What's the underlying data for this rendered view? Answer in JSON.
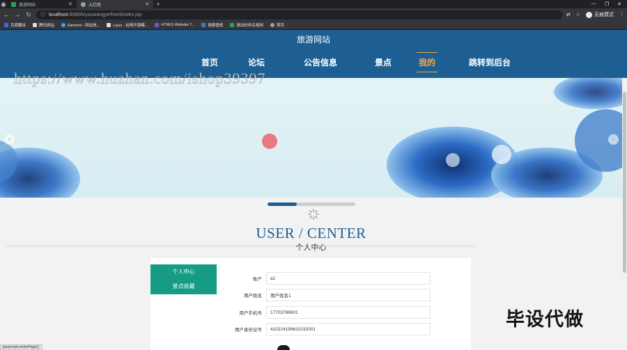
{
  "browser": {
    "tabs": [
      {
        "label": "旅游网站",
        "active": false
      },
      {
        "label": "入口页",
        "active": true
      }
    ],
    "new_tab_symbol": "+",
    "url_host": "localhost",
    "url_path": ":8080/lvyouwangye/front/index.jsp",
    "incognito_label": "无痕模式",
    "bookmarks": [
      {
        "label": "百度翻译",
        "color": "#3b6fd8"
      },
      {
        "label": "腾讯网站",
        "color": "#dddddd"
      },
      {
        "label": "Element - 网站快...",
        "color": "#409eff"
      },
      {
        "label": "Layui - 经典开源模...",
        "color": "#dddddd"
      },
      {
        "label": "HTML5 Website T...",
        "color": "#6a5acd"
      },
      {
        "label": "搜索壁纸",
        "color": "#3a7bd5"
      },
      {
        "label": "滚动的命名规则",
        "color": "#2e9e5b"
      },
      {
        "label": "首页",
        "color": "#9aa0a6"
      }
    ]
  },
  "site": {
    "title": "旅游网站",
    "nav": [
      {
        "label": "首页",
        "active": false
      },
      {
        "label": "论坛",
        "active": false
      },
      {
        "label": "公告信息",
        "active": false
      },
      {
        "label": "景点",
        "active": false
      },
      {
        "label": "我的",
        "active": true
      },
      {
        "label": "跳转到后台",
        "active": false
      }
    ],
    "watermark": "https://www.huzhan.com/ishop39397"
  },
  "carousel": {
    "progress": 0.33
  },
  "user_center": {
    "title": "USER / CENTER",
    "subtitle": "个人中心",
    "menu": [
      {
        "label": "个人中心"
      },
      {
        "label": "景点收藏"
      }
    ],
    "fields": [
      {
        "label": "账户",
        "value": "a1"
      },
      {
        "label": "用户姓名",
        "value": "用户姓名1"
      },
      {
        "label": "用户手机号",
        "value": "17703786901"
      },
      {
        "label": "用户身份证号",
        "value": "410224199610232001"
      }
    ]
  },
  "promo_text": "毕设代做",
  "status_bar": "javascript:centerPage();",
  "colors": {
    "header": "#1d5f93",
    "nav_active": "#f0a84a",
    "side_menu": "#169c84",
    "title_blue": "#1d5f93"
  }
}
